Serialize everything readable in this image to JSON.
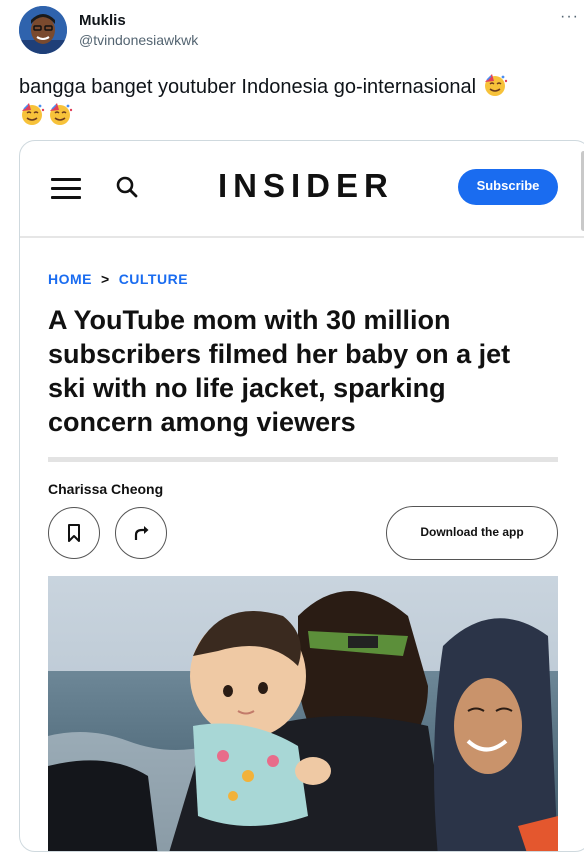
{
  "tweet": {
    "display_name": "Muklis",
    "handle": "@tvindonesiawkwk",
    "more_icon": "more-icon",
    "text": "bangga banget youtuber Indonesia go-internasional",
    "emojis": [
      "partying-face-emoji",
      "partying-face-emoji",
      "partying-face-emoji"
    ]
  },
  "insider": {
    "logo": "INSIDER",
    "subscribe_label": "Subscribe",
    "breadcrumb": {
      "home": "HOME",
      "separator": ">",
      "section": "CULTURE"
    },
    "headline": "A YouTube mom with 30 million subscribers filmed her baby on a jet ski with no life jacket, sparking concern among viewers",
    "author": "Charissa Cheong",
    "download_label": "Download the app",
    "accent_color": "#1a6cf0"
  }
}
